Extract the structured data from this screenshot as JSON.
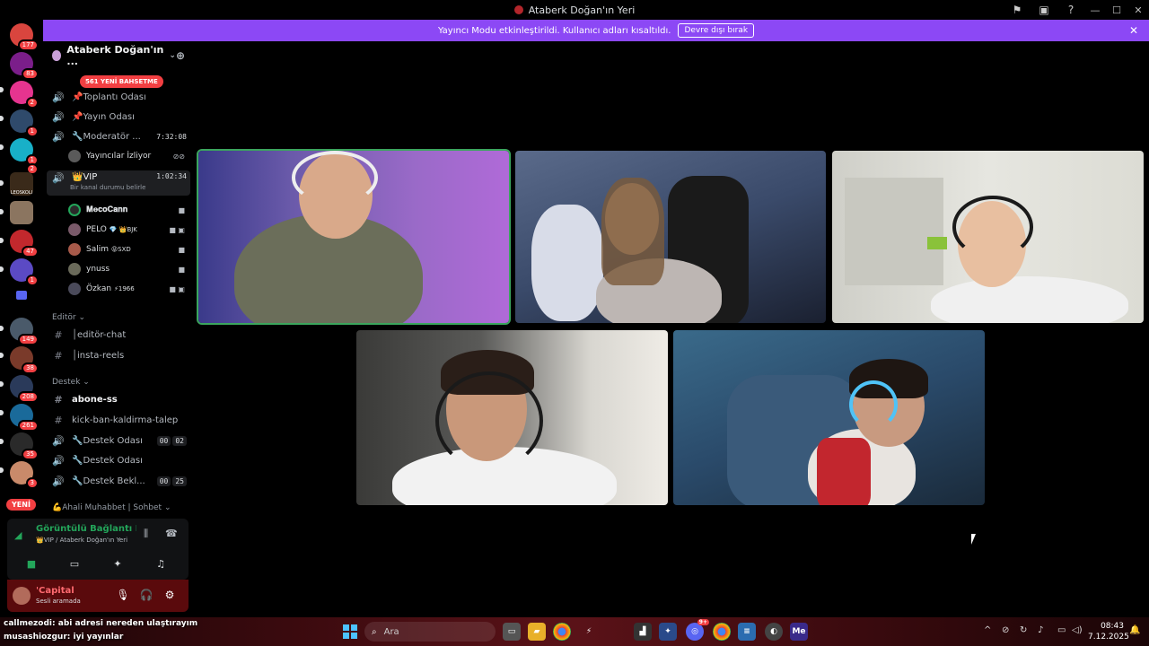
{
  "window": {
    "title": "Ataberk Doğan'ın Yeri"
  },
  "banner": {
    "text": "Yayıncı Modu etkinleştirildi. Kullanıcı adları kısaltıldı.",
    "button": "Devre dışı bırak"
  },
  "rail": {
    "badges": [
      "177",
      "83",
      "2",
      "1",
      "1",
      "2",
      "47",
      "1",
      "149",
      "38",
      "208",
      "261",
      "35",
      "3"
    ],
    "server_label": "LEOSKOLI",
    "new_label": "YENİ"
  },
  "server": {
    "name": "Ataberk Doğan'ın ..."
  },
  "mention_pill": "561 YENİ BAHSETME",
  "channels": {
    "toplanti": "📌Toplantı Odası",
    "yayin": "📌Yayın Odası",
    "moderator": "🔧Moderatör ...",
    "moderator_time": "7:32:08",
    "yayincilar": "Yayıncılar İzliyor",
    "vip": "👑VIP",
    "vip_status": "Bir kanal durumu belirle",
    "vip_time": "1:02:34",
    "vip_users": [
      {
        "name": "𝐌𝐞𝐜𝐨𝐂𝐚𝐧𝐧"
      },
      {
        "name": "PELO",
        "extra": "💎 👑BJK"
      },
      {
        "name": "Salim",
        "extra": "😝SXD"
      },
      {
        "name": "ynuss"
      },
      {
        "name": "Özkan",
        "extra": "⚡1966"
      }
    ],
    "cat_editor": "Editör",
    "editor_chat": "│editör-chat",
    "insta_reels": "│insta-reels",
    "cat_destek": "Destek",
    "abone_ss": "abone-ss",
    "kick_ban": "kick-ban-kaldirma-talep",
    "destek1": "🔧Destek Odası",
    "destek1_times": [
      "00",
      "02"
    ],
    "destek2": "🔧Destek Odası",
    "destek_bekleme": "🔧Destek Bekl...",
    "destek_bekleme_times": [
      "00",
      "25"
    ],
    "cat_ahali": "💪Ahali Muhabbet | Sohbet"
  },
  "voice": {
    "title": "Görüntülü Bağlantı Kurul",
    "subtitle": "👑VIP / Ataberk Doğan'ın Yeri"
  },
  "user": {
    "name": "'Capital",
    "status": "Sesli aramada"
  },
  "overlay": [
    {
      "user": "callmezodi",
      "text": ": abi adresi nereden ulaştırayım"
    },
    {
      "user": "musashiozgur",
      "text": ": iyi yayınlar"
    }
  ],
  "taskbar": {
    "search_placeholder": "Ara",
    "discord_badge": "9+",
    "time": "08:43",
    "date": "7.12.2025"
  }
}
